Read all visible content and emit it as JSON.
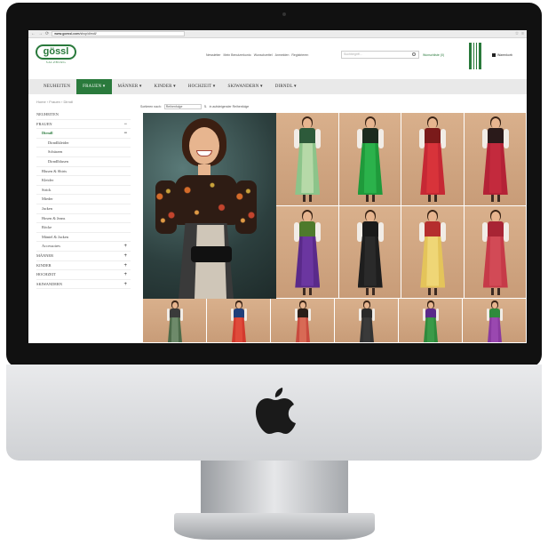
{
  "browser": {
    "url_domain": "www.goessl.com",
    "url_path": "/shop/dirndl/",
    "star": "☆",
    "menu": "≡"
  },
  "site": {
    "logo_text": "gössl",
    "logo_sub": "SALZBURG",
    "top_links": [
      "Newsletter",
      "Mein Benutzerkonto",
      "Wunschzettel",
      "Anmelden",
      "Registrieren"
    ],
    "search_placeholder": "Suchbegriff...",
    "wishlist": "Wunschliste (0)",
    "cart": "Warenkorb"
  },
  "main_nav": [
    {
      "label": "NEUHEITEN",
      "active": false
    },
    {
      "label": "FRAUEN ▾",
      "active": true
    },
    {
      "label": "MÄNNER ▾",
      "active": false
    },
    {
      "label": "KINDER ▾",
      "active": false
    },
    {
      "label": "HOCHZEIT ▾",
      "active": false
    },
    {
      "label": "SKIWANDERN ▾",
      "active": false
    },
    {
      "label": "DIRNDL ▾",
      "active": false
    }
  ],
  "breadcrumb": "Home › Frauen › Dirndl",
  "sort": {
    "label": "Sortieren nach:",
    "selected": "Reihenfolge",
    "direction": "in aufsteigender Reihenfolge"
  },
  "sidebar": [
    {
      "label": "NEUHEITEN",
      "level": 1,
      "toggle": "",
      "selected": false
    },
    {
      "label": "FRAUEN",
      "level": 1,
      "toggle": "−",
      "selected": false
    },
    {
      "label": "Dirndl",
      "level": 2,
      "toggle": "−",
      "selected": true
    },
    {
      "label": "Dirndlkleider",
      "level": 3,
      "toggle": "",
      "selected": false
    },
    {
      "label": "Schürzen",
      "level": 3,
      "toggle": "",
      "selected": false
    },
    {
      "label": "Dirndlblusen",
      "level": 3,
      "toggle": "",
      "selected": false
    },
    {
      "label": "Blusen & Shirts",
      "level": 2,
      "toggle": "",
      "selected": false
    },
    {
      "label": "Kleider",
      "level": 2,
      "toggle": "",
      "selected": false
    },
    {
      "label": "Strick",
      "level": 2,
      "toggle": "",
      "selected": false
    },
    {
      "label": "Mieder",
      "level": 2,
      "toggle": "",
      "selected": false
    },
    {
      "label": "Jacken",
      "level": 2,
      "toggle": "",
      "selected": false
    },
    {
      "label": "Hosen & Jeans",
      "level": 2,
      "toggle": "",
      "selected": false
    },
    {
      "label": "Röcke",
      "level": 2,
      "toggle": "",
      "selected": false
    },
    {
      "label": "Mäntel & Jacken",
      "level": 2,
      "toggle": "",
      "selected": false
    },
    {
      "label": "Accessoires",
      "level": 2,
      "toggle": "+",
      "selected": false
    },
    {
      "label": "MÄNNER",
      "level": 1,
      "toggle": "+",
      "selected": false
    },
    {
      "label": "KINDER",
      "level": 1,
      "toggle": "+",
      "selected": false
    },
    {
      "label": "HOCHZEIT",
      "level": 1,
      "toggle": "+",
      "selected": false
    },
    {
      "label": "SKIWANDERN",
      "level": 1,
      "toggle": "+",
      "selected": false
    }
  ],
  "colors": {
    "brand_green": "#2a7a3c",
    "tile_bg": "#d9b08c"
  },
  "products": [
    {
      "bodice": "#2d5a3a",
      "skirt": "#8cc48a",
      "apron": "#b6d9a8"
    },
    {
      "bodice": "#1c2b1f",
      "skirt": "#1f9a3b",
      "apron": "#2bb24b"
    },
    {
      "bodice": "#7a1a1a",
      "skirt": "#c62834",
      "apron": "#d8333a"
    },
    {
      "bodice": "#2a1a1a",
      "skirt": "#b42236",
      "apron": "#c32a3d"
    },
    {
      "bodice": "#4e7a2c",
      "skirt": "#5a2a8a",
      "apron": "#6b36a0"
    },
    {
      "bodice": "#1a1a1a",
      "skirt": "#1e1e1e",
      "apron": "#2a2a2a"
    },
    {
      "bodice": "#b52e2e",
      "skirt": "#e4c45a",
      "apron": "#efd676"
    },
    {
      "bodice": "#a82434",
      "skirt": "#c63a48",
      "apron": "#d24a56"
    },
    {
      "bodice": "#3a3a3a",
      "skirt": "#4d6b4a",
      "apron": "#6e8a6a"
    },
    {
      "bodice": "#1f3f7a",
      "skirt": "#d33a2e",
      "apron": "#e04a3a"
    },
    {
      "bodice": "#2a1e18",
      "skirt": "#c94a3e",
      "apron": "#d86a55"
    },
    {
      "bodice": "#2a2a2a",
      "skirt": "#333333",
      "apron": "#3a3a3a"
    },
    {
      "bodice": "#5a2a8a",
      "skirt": "#2f8a3c",
      "apron": "#3a9a48"
    },
    {
      "bodice": "#2f8a3c",
      "skirt": "#8a3aa0",
      "apron": "#9a48b0"
    }
  ]
}
